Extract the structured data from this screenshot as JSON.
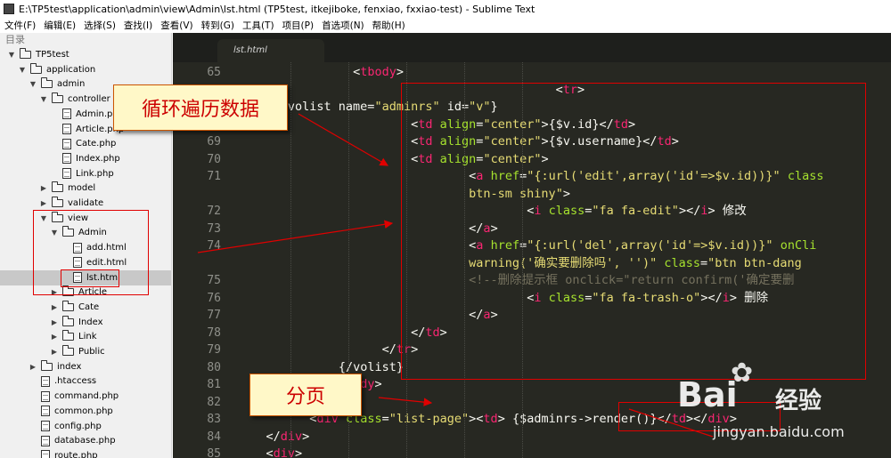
{
  "window": {
    "title": "E:\\TP5test\\application\\admin\\view\\Admin\\lst.html (TP5test, itkejiboke, fenxiao, fxxiao-test) - Sublime Text"
  },
  "menu": [
    "文件(F)",
    "编辑(E)",
    "选择(S)",
    "查找(I)",
    "查看(V)",
    "转到(G)",
    "工具(T)",
    "项目(P)",
    "首选项(N)",
    "帮助(H)"
  ],
  "sidebar": {
    "header": "目录",
    "tree": [
      {
        "label": "TP5test",
        "type": "folder",
        "depth": 0,
        "expanded": true
      },
      {
        "label": "application",
        "type": "folder",
        "depth": 1,
        "expanded": true
      },
      {
        "label": "admin",
        "type": "folder",
        "depth": 2,
        "expanded": true
      },
      {
        "label": "controller",
        "type": "folder",
        "depth": 3,
        "expanded": true
      },
      {
        "label": "Admin.php",
        "type": "file",
        "depth": 4
      },
      {
        "label": "Article.php",
        "type": "file",
        "depth": 4
      },
      {
        "label": "Cate.php",
        "type": "file",
        "depth": 4
      },
      {
        "label": "Index.php",
        "type": "file",
        "depth": 4
      },
      {
        "label": "Link.php",
        "type": "file",
        "depth": 4
      },
      {
        "label": "model",
        "type": "folder",
        "depth": 3,
        "expanded": false
      },
      {
        "label": "validate",
        "type": "folder",
        "depth": 3,
        "expanded": false
      },
      {
        "label": "view",
        "type": "folder",
        "depth": 3,
        "expanded": true
      },
      {
        "label": "Admin",
        "type": "folder",
        "depth": 4,
        "expanded": true
      },
      {
        "label": "add.html",
        "type": "file",
        "depth": 5
      },
      {
        "label": "edit.html",
        "type": "file",
        "depth": 5
      },
      {
        "label": "lst.html",
        "type": "file",
        "depth": 5,
        "selected": true
      },
      {
        "label": "Article",
        "type": "folder",
        "depth": 4,
        "expanded": false
      },
      {
        "label": "Cate",
        "type": "folder",
        "depth": 4,
        "expanded": false
      },
      {
        "label": "Index",
        "type": "folder",
        "depth": 4,
        "expanded": false
      },
      {
        "label": "Link",
        "type": "folder",
        "depth": 4,
        "expanded": false
      },
      {
        "label": "Public",
        "type": "folder",
        "depth": 4,
        "expanded": false
      },
      {
        "label": "index",
        "type": "folder",
        "depth": 2,
        "expanded": false
      },
      {
        "label": ".htaccess",
        "type": "file",
        "depth": 2
      },
      {
        "label": "command.php",
        "type": "file",
        "depth": 2
      },
      {
        "label": "common.php",
        "type": "file",
        "depth": 2
      },
      {
        "label": "config.php",
        "type": "file",
        "depth": 2
      },
      {
        "label": "database.php",
        "type": "file",
        "depth": 2
      },
      {
        "label": "route.php",
        "type": "file",
        "depth": 2
      }
    ]
  },
  "editor": {
    "tab": "lst.html",
    "lines": [
      {
        "n": "65",
        "indent": 8,
        "segs": [
          [
            "pl",
            "<"
          ],
          [
            "tg",
            "tbody"
          ],
          [
            "pl",
            ">"
          ]
        ]
      },
      {
        "n": "",
        "indent": 0,
        "segs": [
          [
            "pl",
            "                                            <"
          ],
          [
            "tg",
            "tr"
          ],
          [
            "pl",
            ">"
          ]
        ]
      },
      {
        "n": "",
        "indent": 3,
        "segs": [
          [
            "pl",
            "{volist name="
          ],
          [
            "st",
            "\"adminrs\""
          ],
          [
            "pl",
            " id="
          ],
          [
            "st",
            "\"v\""
          ],
          [
            "pl",
            "}"
          ]
        ]
      },
      {
        "n": "",
        "indent": 12,
        "segs": [
          [
            "pl",
            "<"
          ],
          [
            "tg",
            "td"
          ],
          [
            "at",
            " align"
          ],
          [
            "pl",
            "="
          ],
          [
            "st",
            "\"center\""
          ],
          [
            "pl",
            ">{$v.id}</"
          ],
          [
            "tg",
            "td"
          ],
          [
            "pl",
            ">"
          ]
        ]
      },
      {
        "n": "69",
        "indent": 12,
        "segs": [
          [
            "pl",
            "<"
          ],
          [
            "tg",
            "td"
          ],
          [
            "at",
            " align"
          ],
          [
            "pl",
            "="
          ],
          [
            "st",
            "\"center\""
          ],
          [
            "pl",
            ">{$v.username}</"
          ],
          [
            "tg",
            "td"
          ],
          [
            "pl",
            ">"
          ]
        ]
      },
      {
        "n": "70",
        "indent": 12,
        "segs": [
          [
            "pl",
            "<"
          ],
          [
            "tg",
            "td"
          ],
          [
            "at",
            " align"
          ],
          [
            "pl",
            "="
          ],
          [
            "st",
            "\"center\""
          ],
          [
            "pl",
            ">"
          ]
        ]
      },
      {
        "n": "71",
        "indent": 16,
        "segs": [
          [
            "pl",
            "<"
          ],
          [
            "tg",
            "a"
          ],
          [
            "at",
            " href"
          ],
          [
            "pl",
            "="
          ],
          [
            "st",
            "\"{:url('edit',array('id'=>$v.id))}\""
          ],
          [
            "at",
            " class"
          ]
        ]
      },
      {
        "n": "",
        "indent": 16,
        "segs": [
          [
            "st",
            "btn-sm shiny\""
          ],
          [
            "pl",
            ">"
          ]
        ]
      },
      {
        "n": "72",
        "indent": 20,
        "segs": [
          [
            "pl",
            "<"
          ],
          [
            "tg",
            "i"
          ],
          [
            "at",
            " class"
          ],
          [
            "pl",
            "="
          ],
          [
            "st",
            "\"fa fa-edit\""
          ],
          [
            "pl",
            "></"
          ],
          [
            "tg",
            "i"
          ],
          [
            "pl",
            "> 修改"
          ]
        ]
      },
      {
        "n": "73",
        "indent": 16,
        "segs": [
          [
            "pl",
            "</"
          ],
          [
            "tg",
            "a"
          ],
          [
            "pl",
            ">"
          ]
        ]
      },
      {
        "n": "74",
        "indent": 16,
        "segs": [
          [
            "pl",
            "<"
          ],
          [
            "tg",
            "a"
          ],
          [
            "at",
            " href"
          ],
          [
            "pl",
            "="
          ],
          [
            "st",
            "\"{:url('del',array('id'=>$v.id))}\""
          ],
          [
            "at",
            " onCli"
          ]
        ]
      },
      {
        "n": "",
        "indent": 16,
        "segs": [
          [
            "st",
            "warning('确实要删除吗', '')\""
          ],
          [
            "at",
            " class"
          ],
          [
            "pl",
            "="
          ],
          [
            "st",
            "\"btn btn-dang"
          ]
        ]
      },
      {
        "n": "75",
        "indent": 16,
        "segs": [
          [
            "cm",
            "<!--删除提示框 onclick=\"return confirm('确定要删"
          ]
        ]
      },
      {
        "n": "76",
        "indent": 20,
        "segs": [
          [
            "pl",
            "<"
          ],
          [
            "tg",
            "i"
          ],
          [
            "at",
            " class"
          ],
          [
            "pl",
            "="
          ],
          [
            "st",
            "\"fa fa-trash-o\""
          ],
          [
            "pl",
            "></"
          ],
          [
            "tg",
            "i"
          ],
          [
            "pl",
            "> 删除"
          ]
        ]
      },
      {
        "n": "77",
        "indent": 16,
        "segs": [
          [
            "pl",
            "</"
          ],
          [
            "tg",
            "a"
          ],
          [
            "pl",
            ">"
          ]
        ]
      },
      {
        "n": "78",
        "indent": 12,
        "segs": [
          [
            "pl",
            "</"
          ],
          [
            "tg",
            "td"
          ],
          [
            "pl",
            ">"
          ]
        ]
      },
      {
        "n": "79",
        "indent": 10,
        "segs": [
          [
            "pl",
            "</"
          ],
          [
            "tg",
            "tr"
          ],
          [
            "pl",
            ">"
          ]
        ]
      },
      {
        "n": "80",
        "indent": 7,
        "segs": [
          [
            "pl",
            "{/volist}"
          ]
        ]
      },
      {
        "n": "81",
        "indent": 6,
        "segs": [
          [
            "pl",
            "</"
          ],
          [
            "tg",
            "tbody"
          ],
          [
            "pl",
            ">"
          ]
        ]
      },
      {
        "n": "82",
        "indent": 4,
        "segs": [
          [
            "pl",
            "</"
          ],
          [
            "tg",
            "table"
          ],
          [
            "pl",
            ">"
          ]
        ]
      },
      {
        "n": "83",
        "indent": 5,
        "segs": [
          [
            "pl",
            "<"
          ],
          [
            "tg",
            "div"
          ],
          [
            "at",
            " class"
          ],
          [
            "pl",
            "="
          ],
          [
            "st",
            "\"list-page\""
          ],
          [
            "pl",
            "><"
          ],
          [
            "tg",
            "td"
          ],
          [
            "pl",
            "> {$adminrs->render()}</"
          ],
          [
            "tg",
            "td"
          ],
          [
            "pl",
            "></"
          ],
          [
            "tg",
            "div"
          ],
          [
            "pl",
            ">"
          ]
        ]
      },
      {
        "n": "84",
        "indent": 2,
        "segs": [
          [
            "pl",
            "</"
          ],
          [
            "tg",
            "div"
          ],
          [
            "pl",
            ">"
          ]
        ]
      },
      {
        "n": "85",
        "indent": 2,
        "segs": [
          [
            "pl",
            "<"
          ],
          [
            "tg",
            "div"
          ],
          [
            "pl",
            ">"
          ]
        ]
      }
    ]
  },
  "annotations": {
    "loop_label": "循环遍历数据",
    "page_label": "分页"
  },
  "watermark": {
    "brand": "Bai",
    "product": "经验",
    "url": "jingyan.baidu.com"
  }
}
